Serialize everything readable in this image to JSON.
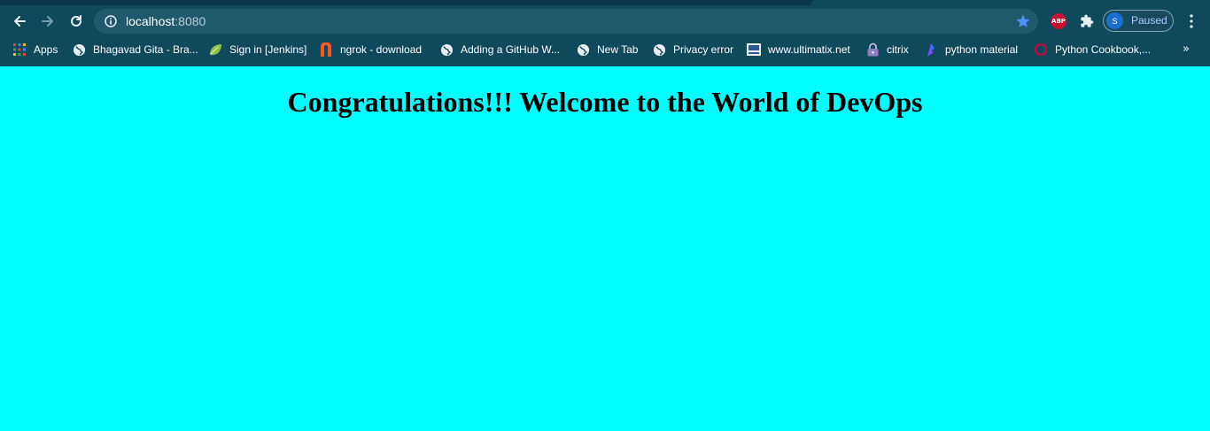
{
  "toolbar": {
    "url_host": "localhost",
    "url_port": ":8080"
  },
  "extensions": {
    "abp_label": "ABP"
  },
  "profile": {
    "initial": "S",
    "status": "Paused"
  },
  "bookmarks": [
    {
      "label": "Apps",
      "icon": "apps-grid-icon"
    },
    {
      "label": "Bhagavad Gita - Bra...",
      "icon": "globe-icon"
    },
    {
      "label": "Sign in [Jenkins]",
      "icon": "leaf-icon"
    },
    {
      "label": "ngrok - download",
      "icon": "ngrok-icon"
    },
    {
      "label": "Adding a GitHub W...",
      "icon": "globe-icon"
    },
    {
      "label": "New Tab",
      "icon": "globe-icon"
    },
    {
      "label": "Privacy error",
      "icon": "globe-icon"
    },
    {
      "label": "www.ultimatix.net",
      "icon": "tata-icon"
    },
    {
      "label": "citrix",
      "icon": "lock-icon"
    },
    {
      "label": "python material",
      "icon": "python-material-icon"
    },
    {
      "label": "Python Cookbook,...",
      "icon": "oreilly-icon"
    }
  ],
  "bookmarks_more": "»",
  "page": {
    "heading": "Congratulations!!! Welcome to the World of DevOps"
  },
  "colors": {
    "page_background": "#00ffff",
    "chrome_background": "#0e4a5c",
    "omnibox_background": "#1e5a6b"
  }
}
